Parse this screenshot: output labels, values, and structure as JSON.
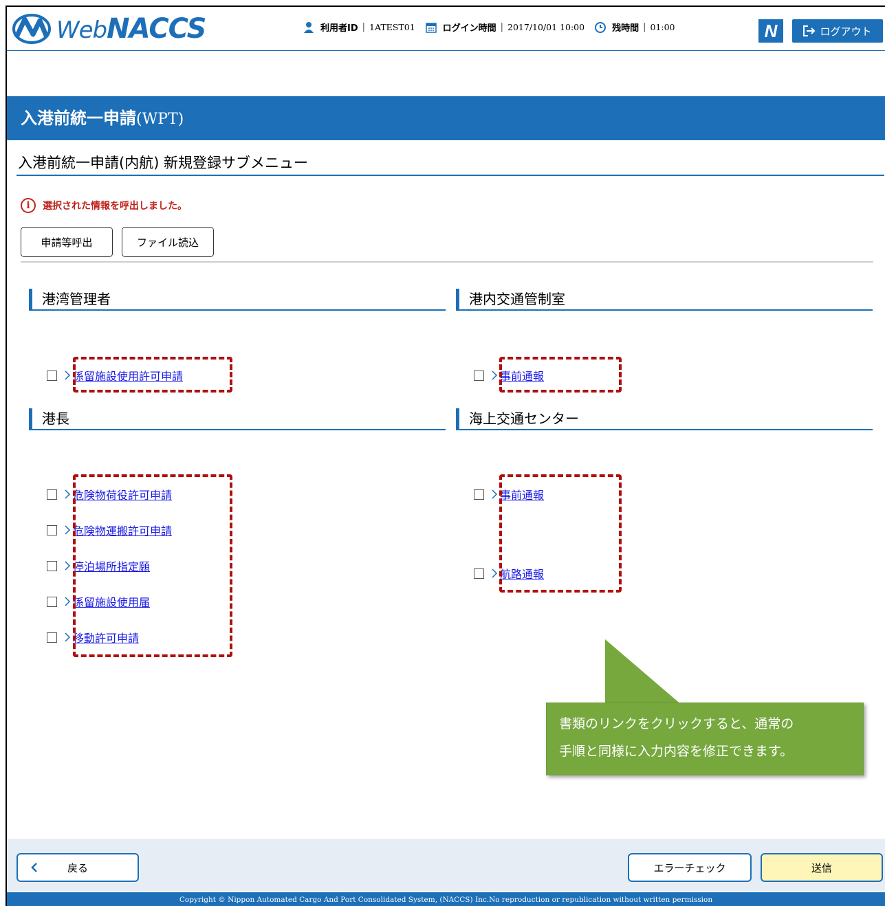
{
  "header": {
    "logo_web": "Web",
    "logo_naccs": "NACCS",
    "user_id_label": "利用者ID",
    "user_id_value": "1ATEST01",
    "login_time_label": "ログイン時間",
    "login_time_value": "2017/10/01 10:00",
    "remaining_label": "残時間",
    "remaining_value": "01:00",
    "n_button": "N",
    "logout_label": "ログアウト"
  },
  "titlebar": {
    "title": "入港前統一申請",
    "code": "(WPT)"
  },
  "subtitle": "入港前統一申請(内航)  新規登録サブメニュー",
  "message": "選択された情報を呼出しました。",
  "toolbar": {
    "call_label": "申請等呼出",
    "file_label": "ファイル読込"
  },
  "sections": [
    {
      "title": "港湾管理者",
      "items": [
        "係留施設使用許可申請"
      ]
    },
    {
      "title": "港内交通管制室",
      "items": [
        "事前通報"
      ]
    },
    {
      "title": "港長",
      "items": [
        "危険物荷役許可申請",
        "危険物運搬許可申請",
        "停泊場所指定願",
        "係留施設使用届",
        "移動許可申請"
      ]
    },
    {
      "title": "海上交通センター",
      "items": [
        "事前通報",
        "航路通報"
      ]
    }
  ],
  "callout": {
    "line1": "書類のリンクをクリックすると、通常の",
    "line2": "手順と同様に入力内容を修正できます。"
  },
  "footer": {
    "back_label": "戻る",
    "error_check_label": "エラーチェック",
    "send_label": "送信",
    "copyright": "Copyright © Nippon Automated Cargo And Port Consolidated System, (NACCS) Inc.No reproduction or republication without written permission"
  },
  "colors": {
    "brand_blue": "#1d6fb8",
    "alert_red": "#c0231c",
    "callout_green": "#76a83e",
    "send_yellow": "#fdf6b8"
  }
}
